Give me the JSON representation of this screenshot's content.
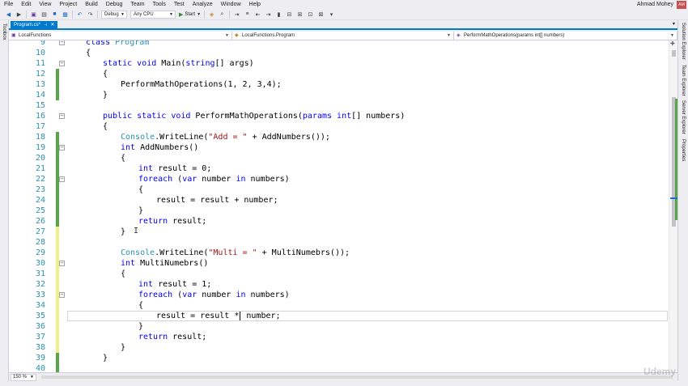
{
  "menu": {
    "items": [
      "File",
      "Edit",
      "View",
      "Project",
      "Build",
      "Debug",
      "Team",
      "Tools",
      "Test",
      "Analyze",
      "Window",
      "Help"
    ],
    "user_name": "Ahmad Mohey",
    "avatar_initials": "AM"
  },
  "toolbar": {
    "configuration": "Debug",
    "platform": "Any CPU",
    "start_label": "Start"
  },
  "left_strip": {
    "toolbox_label": "Toolbox"
  },
  "right_strip": {
    "labels": [
      "Solution Explorer",
      "Team Explorer",
      "Server Explorer",
      "Properties"
    ]
  },
  "tab": {
    "label": "Program.cs*"
  },
  "nav": {
    "project": "LocalFunctions",
    "class": "LocalFunctions.Program",
    "member": "PerformMathOperations(params int[] numbers)"
  },
  "editor": {
    "lines": [
      {
        "n": "9"
      },
      {
        "n": "10"
      },
      {
        "n": "11"
      },
      {
        "n": "12"
      },
      {
        "n": "13"
      },
      {
        "n": "14"
      },
      {
        "n": "15"
      },
      {
        "n": "16"
      },
      {
        "n": "17"
      },
      {
        "n": "18"
      },
      {
        "n": "19"
      },
      {
        "n": "20"
      },
      {
        "n": "21"
      },
      {
        "n": "22"
      },
      {
        "n": "23"
      },
      {
        "n": "24"
      },
      {
        "n": "25"
      },
      {
        "n": "26"
      },
      {
        "n": "27"
      },
      {
        "n": "28"
      },
      {
        "n": "29"
      },
      {
        "n": "30"
      },
      {
        "n": "31"
      },
      {
        "n": "32"
      },
      {
        "n": "33"
      },
      {
        "n": "34"
      },
      {
        "n": "35"
      },
      {
        "n": "36"
      },
      {
        "n": "37"
      },
      {
        "n": "38"
      },
      {
        "n": "39"
      },
      {
        "n": "40"
      }
    ],
    "code": {
      "l9_kw": "class",
      "l9_name": "Program",
      "l10": "{",
      "l11_kw1": "static",
      "l11_kw2": "void",
      "l11_rest1": " Main(",
      "l11_kw3": "string",
      "l11_rest2": "[] args)",
      "l12": "{",
      "l13": "PerformMathOperations(1, 2, 3,4);",
      "l14": "}",
      "l16_kw1": "public",
      "l16_kw2": "static",
      "l16_kw3": "void",
      "l16_rest1": " PerformMathOperations(",
      "l16_kw4": "params",
      "l16_kw5": "int",
      "l16_rest2": "[] numbers)",
      "l17": "{",
      "l18_cls": "Console",
      "l18_rest1": ".WriteLine(",
      "l18_str": "\"Add = \"",
      "l18_rest2": " + AddNumbers());",
      "l19_kw": "int",
      "l19_rest": " AddNumbers()",
      "l20": "{",
      "l21_kw": "int",
      "l21_rest": " result = 0;",
      "l22_kw1": "foreach",
      "l22_rest1": " (",
      "l22_kw2": "var",
      "l22_rest2": " number ",
      "l22_kw3": "in",
      "l22_rest3": " numbers)",
      "l23": "{",
      "l24": "result = result + number;",
      "l25": "}",
      "l26_kw": "return",
      "l26_rest": " result;",
      "l27": "}",
      "l29_cls": "Console",
      "l29_rest1": ".WriteLine(",
      "l29_str": "\"Multi = \"",
      "l29_rest2": " + MultiNumebrs());",
      "l30_kw": "int",
      "l30_rest": " MultiNumebrs()",
      "l31": "{",
      "l32_kw": "int",
      "l32_rest": " result = 1;",
      "l33_kw1": "foreach",
      "l33_rest1": " (",
      "l33_kw2": "var",
      "l33_rest2": " number ",
      "l33_kw3": "in",
      "l33_rest3": " numbers)",
      "l34": "{",
      "l35_a": "result = result *",
      "l35_b": " number;",
      "l36": "}",
      "l37_kw": "return",
      "l37_rest": " result;",
      "l38": "}",
      "l39": "}"
    }
  },
  "zoom": {
    "level": "150 %"
  },
  "watermark": "Udemy"
}
